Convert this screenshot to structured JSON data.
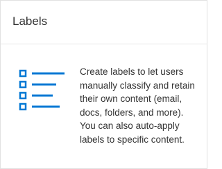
{
  "card": {
    "title": "Labels",
    "description": "Create labels to let users manually classify and retain their own content (email, docs, folders, and more). You can also auto-apply labels to specific content.",
    "icon": "list-icon",
    "accent_color": "#0078d4"
  }
}
